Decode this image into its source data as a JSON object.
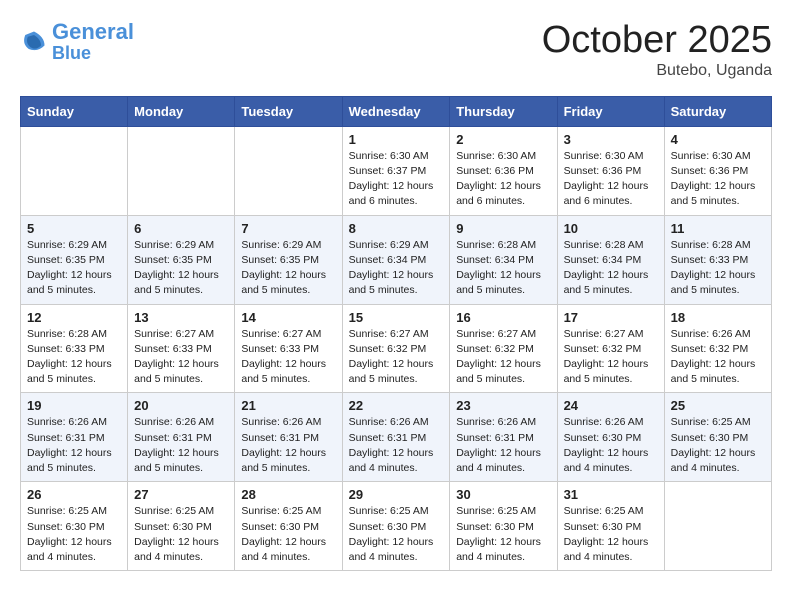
{
  "header": {
    "logo_general": "General",
    "logo_blue": "Blue",
    "month": "October 2025",
    "location": "Butebo, Uganda"
  },
  "weekdays": [
    "Sunday",
    "Monday",
    "Tuesday",
    "Wednesday",
    "Thursday",
    "Friday",
    "Saturday"
  ],
  "weeks": [
    [
      {
        "day": "",
        "info": ""
      },
      {
        "day": "",
        "info": ""
      },
      {
        "day": "",
        "info": ""
      },
      {
        "day": "1",
        "info": "Sunrise: 6:30 AM\nSunset: 6:37 PM\nDaylight: 12 hours\nand 6 minutes."
      },
      {
        "day": "2",
        "info": "Sunrise: 6:30 AM\nSunset: 6:36 PM\nDaylight: 12 hours\nand 6 minutes."
      },
      {
        "day": "3",
        "info": "Sunrise: 6:30 AM\nSunset: 6:36 PM\nDaylight: 12 hours\nand 6 minutes."
      },
      {
        "day": "4",
        "info": "Sunrise: 6:30 AM\nSunset: 6:36 PM\nDaylight: 12 hours\nand 5 minutes."
      }
    ],
    [
      {
        "day": "5",
        "info": "Sunrise: 6:29 AM\nSunset: 6:35 PM\nDaylight: 12 hours\nand 5 minutes."
      },
      {
        "day": "6",
        "info": "Sunrise: 6:29 AM\nSunset: 6:35 PM\nDaylight: 12 hours\nand 5 minutes."
      },
      {
        "day": "7",
        "info": "Sunrise: 6:29 AM\nSunset: 6:35 PM\nDaylight: 12 hours\nand 5 minutes."
      },
      {
        "day": "8",
        "info": "Sunrise: 6:29 AM\nSunset: 6:34 PM\nDaylight: 12 hours\nand 5 minutes."
      },
      {
        "day": "9",
        "info": "Sunrise: 6:28 AM\nSunset: 6:34 PM\nDaylight: 12 hours\nand 5 minutes."
      },
      {
        "day": "10",
        "info": "Sunrise: 6:28 AM\nSunset: 6:34 PM\nDaylight: 12 hours\nand 5 minutes."
      },
      {
        "day": "11",
        "info": "Sunrise: 6:28 AM\nSunset: 6:33 PM\nDaylight: 12 hours\nand 5 minutes."
      }
    ],
    [
      {
        "day": "12",
        "info": "Sunrise: 6:28 AM\nSunset: 6:33 PM\nDaylight: 12 hours\nand 5 minutes."
      },
      {
        "day": "13",
        "info": "Sunrise: 6:27 AM\nSunset: 6:33 PM\nDaylight: 12 hours\nand 5 minutes."
      },
      {
        "day": "14",
        "info": "Sunrise: 6:27 AM\nSunset: 6:33 PM\nDaylight: 12 hours\nand 5 minutes."
      },
      {
        "day": "15",
        "info": "Sunrise: 6:27 AM\nSunset: 6:32 PM\nDaylight: 12 hours\nand 5 minutes."
      },
      {
        "day": "16",
        "info": "Sunrise: 6:27 AM\nSunset: 6:32 PM\nDaylight: 12 hours\nand 5 minutes."
      },
      {
        "day": "17",
        "info": "Sunrise: 6:27 AM\nSunset: 6:32 PM\nDaylight: 12 hours\nand 5 minutes."
      },
      {
        "day": "18",
        "info": "Sunrise: 6:26 AM\nSunset: 6:32 PM\nDaylight: 12 hours\nand 5 minutes."
      }
    ],
    [
      {
        "day": "19",
        "info": "Sunrise: 6:26 AM\nSunset: 6:31 PM\nDaylight: 12 hours\nand 5 minutes."
      },
      {
        "day": "20",
        "info": "Sunrise: 6:26 AM\nSunset: 6:31 PM\nDaylight: 12 hours\nand 5 minutes."
      },
      {
        "day": "21",
        "info": "Sunrise: 6:26 AM\nSunset: 6:31 PM\nDaylight: 12 hours\nand 5 minutes."
      },
      {
        "day": "22",
        "info": "Sunrise: 6:26 AM\nSunset: 6:31 PM\nDaylight: 12 hours\nand 4 minutes."
      },
      {
        "day": "23",
        "info": "Sunrise: 6:26 AM\nSunset: 6:31 PM\nDaylight: 12 hours\nand 4 minutes."
      },
      {
        "day": "24",
        "info": "Sunrise: 6:26 AM\nSunset: 6:30 PM\nDaylight: 12 hours\nand 4 minutes."
      },
      {
        "day": "25",
        "info": "Sunrise: 6:25 AM\nSunset: 6:30 PM\nDaylight: 12 hours\nand 4 minutes."
      }
    ],
    [
      {
        "day": "26",
        "info": "Sunrise: 6:25 AM\nSunset: 6:30 PM\nDaylight: 12 hours\nand 4 minutes."
      },
      {
        "day": "27",
        "info": "Sunrise: 6:25 AM\nSunset: 6:30 PM\nDaylight: 12 hours\nand 4 minutes."
      },
      {
        "day": "28",
        "info": "Sunrise: 6:25 AM\nSunset: 6:30 PM\nDaylight: 12 hours\nand 4 minutes."
      },
      {
        "day": "29",
        "info": "Sunrise: 6:25 AM\nSunset: 6:30 PM\nDaylight: 12 hours\nand 4 minutes."
      },
      {
        "day": "30",
        "info": "Sunrise: 6:25 AM\nSunset: 6:30 PM\nDaylight: 12 hours\nand 4 minutes."
      },
      {
        "day": "31",
        "info": "Sunrise: 6:25 AM\nSunset: 6:30 PM\nDaylight: 12 hours\nand 4 minutes."
      },
      {
        "day": "",
        "info": ""
      }
    ]
  ]
}
